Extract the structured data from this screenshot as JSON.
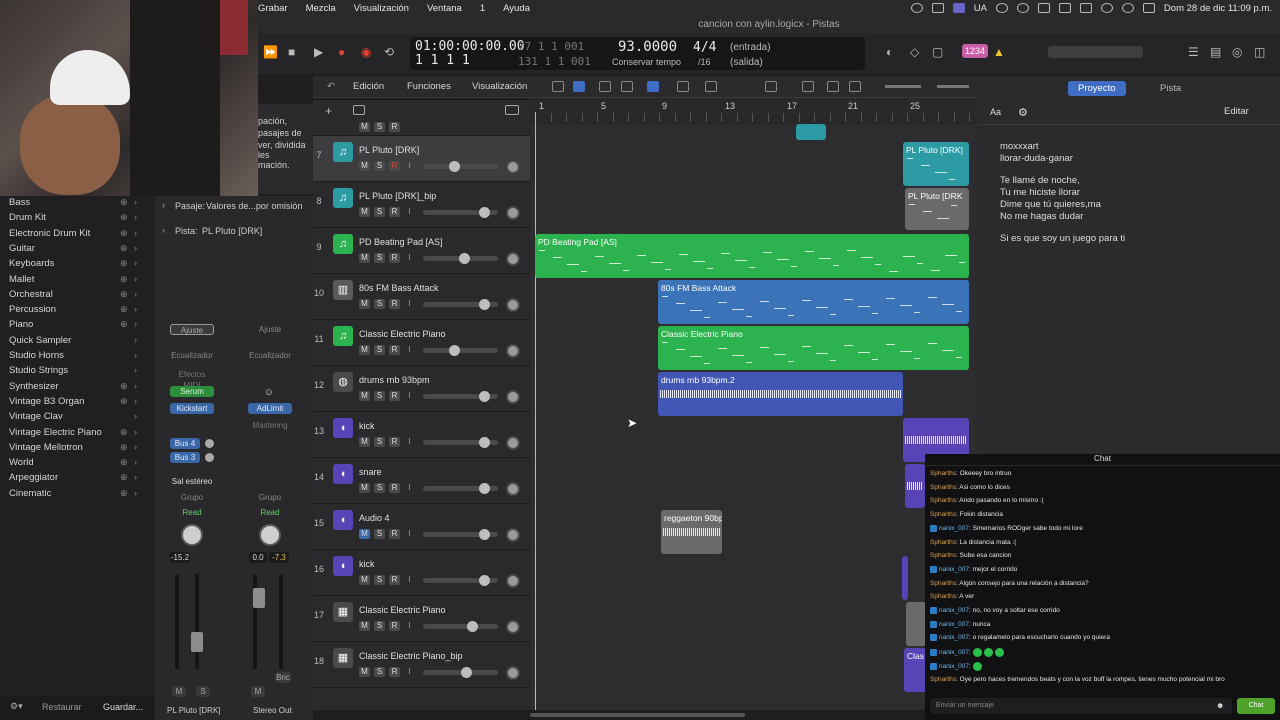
{
  "menubar": {
    "items": [
      "Grabar",
      "Mezcla",
      "Visualización",
      "Ventana",
      "1",
      "Ayuda"
    ],
    "input_source": "UA",
    "clock": "Dom 28 de dic  11:09 p.m."
  },
  "window": {
    "title": "cancion con aylin.logicx - Pistas"
  },
  "transport": {
    "timecode": "01:00:00:00.00",
    "beats_top": "77 1 1 001",
    "beats_main": "1 1 1 1",
    "beats_bottom": "131 1 1 001",
    "tempo": "93.0000",
    "tempo_label": "Conservar tempo",
    "signature": "4/4",
    "division": "/16",
    "in_label": "(entrada)",
    "out_label": "(salida)",
    "count_badge": "1234"
  },
  "library": {
    "items": [
      {
        "label": "Bass",
        "has_add": true
      },
      {
        "label": "Drum Kit",
        "has_add": true
      },
      {
        "label": "Electronic Drum Kit",
        "has_add": true
      },
      {
        "label": "Guitar",
        "has_add": true
      },
      {
        "label": "Keyboards",
        "has_add": true
      },
      {
        "label": "Mallet",
        "has_add": true
      },
      {
        "label": "Orchestral",
        "has_add": true
      },
      {
        "label": "Percussion",
        "has_add": true
      },
      {
        "label": "Piano",
        "has_add": true
      },
      {
        "label": "Quick Sampler",
        "has_add": false
      },
      {
        "label": "Studio Horns",
        "has_add": false
      },
      {
        "label": "Studio Strings",
        "has_add": false
      },
      {
        "label": "Synthesizer",
        "has_add": true
      },
      {
        "label": "Vintage B3 Organ",
        "has_add": true
      },
      {
        "label": "Vintage Clav",
        "has_add": false
      },
      {
        "label": "Vintage Electric Piano",
        "has_add": true
      },
      {
        "label": "Vintage Mellotron",
        "has_add": true
      },
      {
        "label": "World",
        "has_add": true
      },
      {
        "label": "Arpeggiator",
        "has_add": true
      },
      {
        "label": "Cinematic",
        "has_add": true
      }
    ],
    "restore_label": "Restaurar",
    "save_label": "Guardar..."
  },
  "inspector": {
    "notes_lines": [
      "pación,",
      "pasajes de",
      "ver, dividida",
      "les",
      "mación."
    ],
    "passage_label": "Pasaje:",
    "passage_value": "Valores de...por omisión",
    "track_label": "Pista:",
    "track_value": "PL Pluto [DRK]",
    "strip1": {
      "setting": "Ajuste",
      "eq": "Ecualizador",
      "midi_fx": "Efectos MIDI",
      "instrument": "Serum",
      "insert": "Kickstart",
      "sends": [
        "Bus 4",
        "Bus 3"
      ],
      "output": "Sal estéreo",
      "group": "Grupo",
      "automation": "Read",
      "volume": "-15.2",
      "name": "PL Pluto [DRK]"
    },
    "strip2": {
      "setting": "Ajuste",
      "eq": "Ecualizador",
      "insert": "AdLimit",
      "mastering": "Mastering",
      "group": "Grupo",
      "automation": "Read",
      "volume": "0.0",
      "peak": "-7.3",
      "bounce": "Bnc",
      "name": "Stereo Out"
    },
    "mute": "M",
    "solo": "S"
  },
  "arrange_toolbar": {
    "menus": [
      "Edición",
      "Funciones",
      "Visualización"
    ]
  },
  "ruler": {
    "bars": [
      "1",
      "5",
      "9",
      "13",
      "17",
      "21",
      "25"
    ]
  },
  "tracks": [
    {
      "num": "",
      "name": "",
      "type": "partial",
      "rec": false
    },
    {
      "num": "7",
      "name": "PL Pluto [DRK]",
      "type": "midi-cyan",
      "rec": true
    },
    {
      "num": "8",
      "name": "PL Pluto [DRK]_bip",
      "type": "midi-cyan",
      "rec": false
    },
    {
      "num": "9",
      "name": "PD Beating Pad [AS]",
      "type": "midi-green",
      "rec": false
    },
    {
      "num": "10",
      "name": "80s FM Bass Attack",
      "type": "instrument",
      "rec": false
    },
    {
      "num": "11",
      "name": "Classic Electric Piano",
      "type": "midi-green",
      "rec": false
    },
    {
      "num": "12",
      "name": "drums rnb 93bpm",
      "type": "drums",
      "rec": false
    },
    {
      "num": "13",
      "name": "kick",
      "type": "audio",
      "rec": false
    },
    {
      "num": "14",
      "name": "snare",
      "type": "audio",
      "rec": false
    },
    {
      "num": "15",
      "name": "Audio 4",
      "type": "audio",
      "rec": false
    },
    {
      "num": "16",
      "name": "kick",
      "type": "audio",
      "rec": false
    },
    {
      "num": "17",
      "name": "Classic Electric Piano",
      "type": "piano",
      "rec": false
    },
    {
      "num": "18",
      "name": "Classic Electric Piano_bip",
      "type": "piano",
      "rec": false
    }
  ],
  "regions": {
    "pluto": "PL Pluto [DRK]",
    "pluto_bip": "PL Pluto [DRK",
    "pad": "PD Beating Pad [AS]",
    "bass": "80s FM Bass Attack",
    "epiano": "Classic Electric Piano",
    "drums": "drums rnb 93bpm.2",
    "reggaeton": "reggaeton 90bp",
    "clas": "Clas"
  },
  "notes_panel": {
    "tab_project": "Proyecto",
    "tab_track": "Pista",
    "edit": "Editar",
    "font_btn": "Aa",
    "lines": [
      "moxxxart",
      "llorar-duda-ganar",
      "",
      "Te llamé de noche,",
      "Tu me hiciste llorar",
      "Dime que tú quieres,ma",
      "No me hagas dudar",
      "",
      "Si es que soy un juego para ti"
    ]
  },
  "chat": {
    "title": "Chat",
    "messages": [
      {
        "user": "Spharths",
        "badge": false,
        "text": "Okeeey bro intruo"
      },
      {
        "user": "Spharths",
        "badge": false,
        "text": "Asi como lo dices"
      },
      {
        "user": "Spharths",
        "badge": false,
        "text": "Ando pasando en lo mismo :("
      },
      {
        "user": "Spharths",
        "badge": false,
        "text": "Fokin distancia"
      },
      {
        "user": "nanix_007",
        "badge": true,
        "text": "Smemarios RODger sabe todo mi lore"
      },
      {
        "user": "Spharths",
        "badge": false,
        "text": "La distancia mata :("
      },
      {
        "user": "Spharths",
        "badge": false,
        "text": "Sube esa cancion"
      },
      {
        "user": "nanix_007",
        "badge": true,
        "text": "mejor el corrido"
      },
      {
        "user": "Spharths",
        "badge": false,
        "text": "Algún consejo para una relación a distancia?"
      },
      {
        "user": "Spharths",
        "badge": false,
        "text": "A ver"
      },
      {
        "user": "nanix_007",
        "badge": true,
        "text": "no, no voy a soltar ese corrido"
      },
      {
        "user": "nanix_007",
        "badge": true,
        "text": "nunca"
      },
      {
        "user": "nanix_007",
        "badge": true,
        "text": "o regalamelo para escucharlo cuando yo quiera"
      },
      {
        "user": "nanix_007",
        "badge": true,
        "text": "",
        "emotes": 3
      },
      {
        "user": "nanix_007",
        "badge": true,
        "text": "",
        "emotes": 1
      },
      {
        "user": "Spharths",
        "badge": false,
        "text": "Oye pero haces tremendos beats y con la voz buff la rompes, tienes mucho potencial mi bro"
      }
    ],
    "input_placeholder": "Enviar un mensaje",
    "send_label": "Chat"
  },
  "colors": {
    "cyan_region": "#2d9ba3",
    "green_region": "#2cb34f",
    "blue_region": "#3a73b8",
    "accent_blue": "#3f6dc5",
    "record_red": "#e0403a"
  }
}
